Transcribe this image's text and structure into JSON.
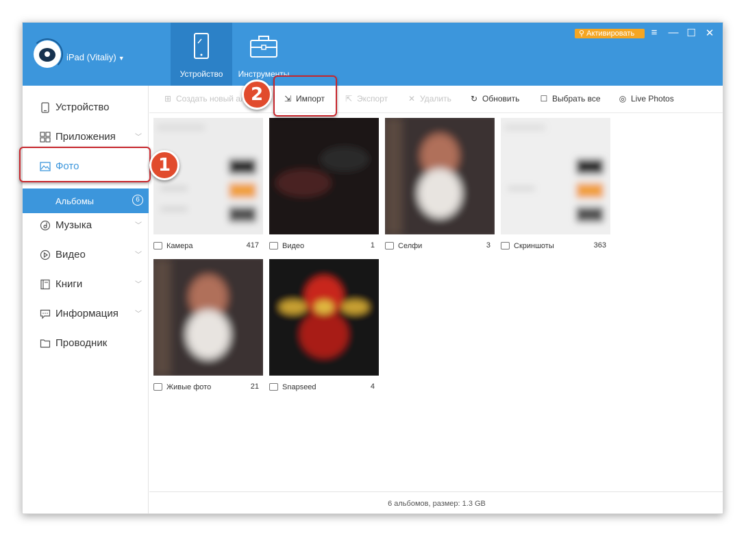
{
  "header": {
    "device_name": "iPad (Vitaliy)",
    "tabs": [
      {
        "label": "Устройство",
        "icon": "tablet-icon",
        "active": true
      },
      {
        "label": "Инструменты",
        "icon": "toolbox-icon",
        "active": false
      }
    ],
    "activate_label": "Активировать",
    "window_controls": [
      "≡",
      "—",
      "☐",
      "✕"
    ]
  },
  "sidebar": {
    "items": [
      {
        "label": "Устройство",
        "icon": "device-icon",
        "expandable": false
      },
      {
        "label": "Приложения",
        "icon": "apps-icon",
        "expandable": true
      },
      {
        "label": "Фото",
        "icon": "photo-icon",
        "expandable": false,
        "active": true
      },
      {
        "label": "Музыка",
        "icon": "music-icon",
        "expandable": true
      },
      {
        "label": "Видео",
        "icon": "video-icon",
        "expandable": true
      },
      {
        "label": "Книги",
        "icon": "books-icon",
        "expandable": true
      },
      {
        "label": "Информация",
        "icon": "info-icon",
        "expandable": true
      },
      {
        "label": "Проводник",
        "icon": "folder-icon",
        "expandable": false
      }
    ],
    "subitem": {
      "label": "Альбомы",
      "count": "6"
    }
  },
  "toolbar": {
    "create_album": "Создать новый ал...",
    "import": "Импорт",
    "export": "Экспорт",
    "delete": "Удалить",
    "refresh": "Обновить",
    "select_all": "Выбрать все",
    "live_photos": "Live Photos"
  },
  "albums": [
    {
      "name": "Камера",
      "count": "417"
    },
    {
      "name": "Видео",
      "count": "1"
    },
    {
      "name": "Селфи",
      "count": "3"
    },
    {
      "name": "Скриншоты",
      "count": "363"
    },
    {
      "name": "Живые фото",
      "count": "21"
    },
    {
      "name": "Snapseed",
      "count": "4"
    }
  ],
  "status": "6 альбомов, размер: 1.3 GB",
  "annotations": {
    "step1": "1",
    "step2": "2"
  },
  "colors": {
    "accent": "#3c96dc",
    "highlight": "#c7262c",
    "badge": "#e14b2d",
    "activate": "#f5a623"
  }
}
